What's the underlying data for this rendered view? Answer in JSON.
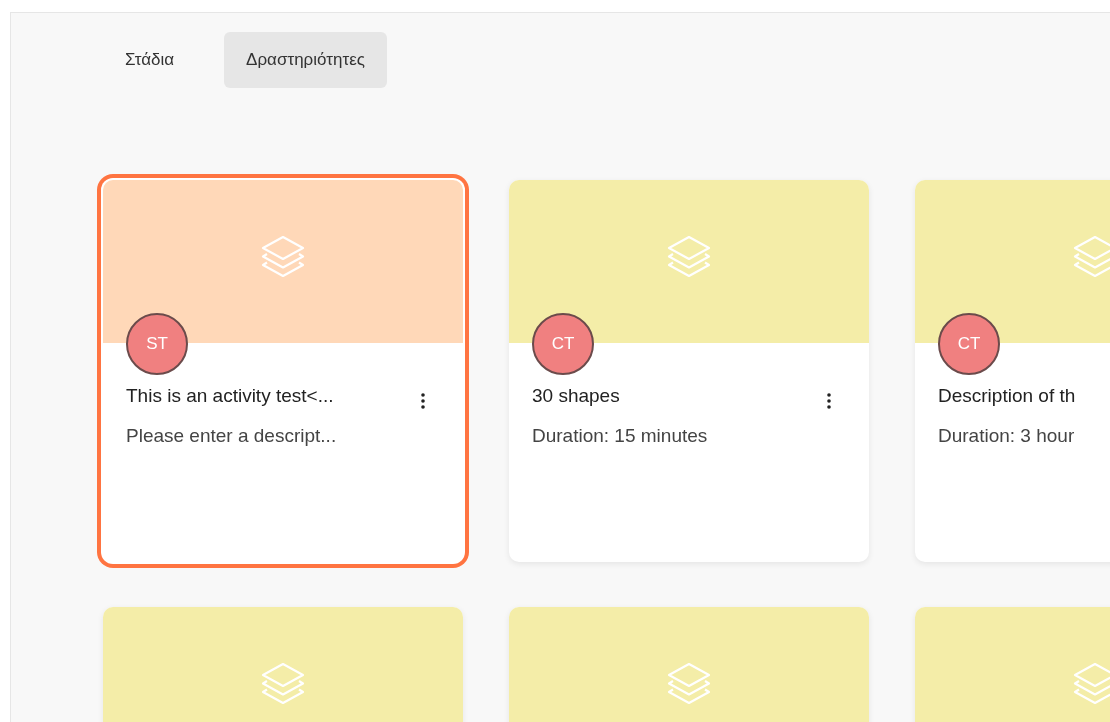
{
  "tabs": [
    {
      "label": "Στάδια",
      "selected": false
    },
    {
      "label": "Δραστηριότητες",
      "selected": true
    }
  ],
  "cards": [
    {
      "color": "#ffd8b8",
      "selected": true,
      "initials": "ST",
      "title": "This is an activity test<...",
      "subtitle": "Please enter a descript..."
    },
    {
      "color": "#f4eda8",
      "selected": false,
      "initials": "CT",
      "title": "30 shapes",
      "subtitle": "Duration: 15 minutes"
    },
    {
      "color": "#f4eda8",
      "selected": false,
      "initials": "CT",
      "title": "Description of th",
      "subtitle": "Duration: 3 hour"
    },
    {
      "color": "#f4eda8",
      "selected": false
    },
    {
      "color": "#f4eda8",
      "selected": false
    },
    {
      "color": "#f4eda8",
      "selected": false
    }
  ]
}
